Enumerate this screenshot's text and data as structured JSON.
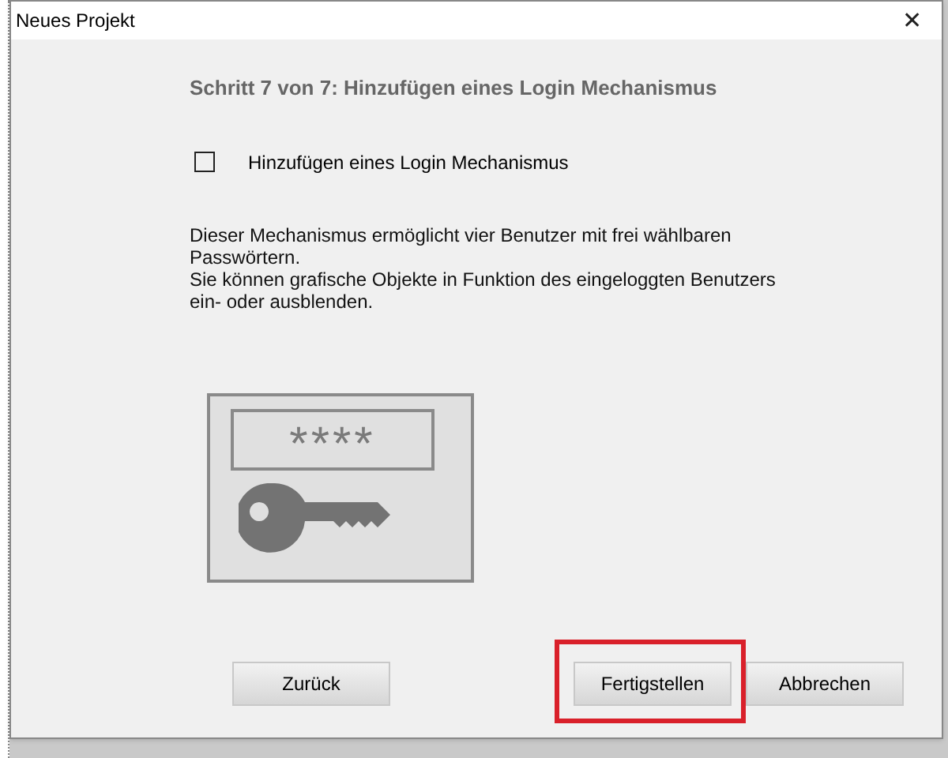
{
  "window": {
    "title": "Neues Projekt",
    "close": "✕"
  },
  "heading": "Schritt 7 von 7: Hinzufügen eines Login Mechanismus",
  "option": {
    "label": "Hinzufügen eines Login Mechanismus",
    "checked": false
  },
  "description": [
    "Dieser Mechanismus ermöglicht vier Benutzer mit frei wählbaren Passwörtern.",
    "Sie können grafische Objekte in Funktion des eingeloggten Benutzers ein- oder ausblenden."
  ],
  "illustration": {
    "password": "****"
  },
  "buttons": [
    {
      "label": "Zurück",
      "highlighted": false
    },
    {
      "label": "Fertigstellen",
      "highlighted": true
    },
    {
      "label": "Abbrechen",
      "highlighted": false
    }
  ]
}
